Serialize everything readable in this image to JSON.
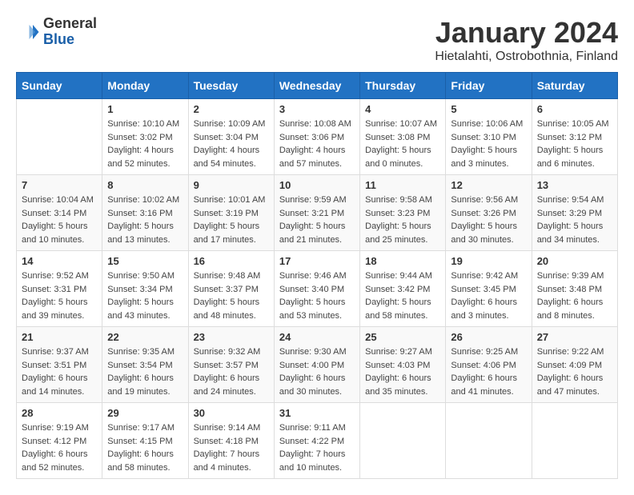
{
  "header": {
    "logo_general": "General",
    "logo_blue": "Blue",
    "month_title": "January 2024",
    "location": "Hietalahti, Ostrobothnia, Finland"
  },
  "days_of_week": [
    "Sunday",
    "Monday",
    "Tuesday",
    "Wednesday",
    "Thursday",
    "Friday",
    "Saturday"
  ],
  "weeks": [
    [
      {
        "day": "",
        "info": ""
      },
      {
        "day": "1",
        "info": "Sunrise: 10:10 AM\nSunset: 3:02 PM\nDaylight: 4 hours\nand 52 minutes."
      },
      {
        "day": "2",
        "info": "Sunrise: 10:09 AM\nSunset: 3:04 PM\nDaylight: 4 hours\nand 54 minutes."
      },
      {
        "day": "3",
        "info": "Sunrise: 10:08 AM\nSunset: 3:06 PM\nDaylight: 4 hours\nand 57 minutes."
      },
      {
        "day": "4",
        "info": "Sunrise: 10:07 AM\nSunset: 3:08 PM\nDaylight: 5 hours\nand 0 minutes."
      },
      {
        "day": "5",
        "info": "Sunrise: 10:06 AM\nSunset: 3:10 PM\nDaylight: 5 hours\nand 3 minutes."
      },
      {
        "day": "6",
        "info": "Sunrise: 10:05 AM\nSunset: 3:12 PM\nDaylight: 5 hours\nand 6 minutes."
      }
    ],
    [
      {
        "day": "7",
        "info": "Sunrise: 10:04 AM\nSunset: 3:14 PM\nDaylight: 5 hours\nand 10 minutes."
      },
      {
        "day": "8",
        "info": "Sunrise: 10:02 AM\nSunset: 3:16 PM\nDaylight: 5 hours\nand 13 minutes."
      },
      {
        "day": "9",
        "info": "Sunrise: 10:01 AM\nSunset: 3:19 PM\nDaylight: 5 hours\nand 17 minutes."
      },
      {
        "day": "10",
        "info": "Sunrise: 9:59 AM\nSunset: 3:21 PM\nDaylight: 5 hours\nand 21 minutes."
      },
      {
        "day": "11",
        "info": "Sunrise: 9:58 AM\nSunset: 3:23 PM\nDaylight: 5 hours\nand 25 minutes."
      },
      {
        "day": "12",
        "info": "Sunrise: 9:56 AM\nSunset: 3:26 PM\nDaylight: 5 hours\nand 30 minutes."
      },
      {
        "day": "13",
        "info": "Sunrise: 9:54 AM\nSunset: 3:29 PM\nDaylight: 5 hours\nand 34 minutes."
      }
    ],
    [
      {
        "day": "14",
        "info": "Sunrise: 9:52 AM\nSunset: 3:31 PM\nDaylight: 5 hours\nand 39 minutes."
      },
      {
        "day": "15",
        "info": "Sunrise: 9:50 AM\nSunset: 3:34 PM\nDaylight: 5 hours\nand 43 minutes."
      },
      {
        "day": "16",
        "info": "Sunrise: 9:48 AM\nSunset: 3:37 PM\nDaylight: 5 hours\nand 48 minutes."
      },
      {
        "day": "17",
        "info": "Sunrise: 9:46 AM\nSunset: 3:40 PM\nDaylight: 5 hours\nand 53 minutes."
      },
      {
        "day": "18",
        "info": "Sunrise: 9:44 AM\nSunset: 3:42 PM\nDaylight: 5 hours\nand 58 minutes."
      },
      {
        "day": "19",
        "info": "Sunrise: 9:42 AM\nSunset: 3:45 PM\nDaylight: 6 hours\nand 3 minutes."
      },
      {
        "day": "20",
        "info": "Sunrise: 9:39 AM\nSunset: 3:48 PM\nDaylight: 6 hours\nand 8 minutes."
      }
    ],
    [
      {
        "day": "21",
        "info": "Sunrise: 9:37 AM\nSunset: 3:51 PM\nDaylight: 6 hours\nand 14 minutes."
      },
      {
        "day": "22",
        "info": "Sunrise: 9:35 AM\nSunset: 3:54 PM\nDaylight: 6 hours\nand 19 minutes."
      },
      {
        "day": "23",
        "info": "Sunrise: 9:32 AM\nSunset: 3:57 PM\nDaylight: 6 hours\nand 24 minutes."
      },
      {
        "day": "24",
        "info": "Sunrise: 9:30 AM\nSunset: 4:00 PM\nDaylight: 6 hours\nand 30 minutes."
      },
      {
        "day": "25",
        "info": "Sunrise: 9:27 AM\nSunset: 4:03 PM\nDaylight: 6 hours\nand 35 minutes."
      },
      {
        "day": "26",
        "info": "Sunrise: 9:25 AM\nSunset: 4:06 PM\nDaylight: 6 hours\nand 41 minutes."
      },
      {
        "day": "27",
        "info": "Sunrise: 9:22 AM\nSunset: 4:09 PM\nDaylight: 6 hours\nand 47 minutes."
      }
    ],
    [
      {
        "day": "28",
        "info": "Sunrise: 9:19 AM\nSunset: 4:12 PM\nDaylight: 6 hours\nand 52 minutes."
      },
      {
        "day": "29",
        "info": "Sunrise: 9:17 AM\nSunset: 4:15 PM\nDaylight: 6 hours\nand 58 minutes."
      },
      {
        "day": "30",
        "info": "Sunrise: 9:14 AM\nSunset: 4:18 PM\nDaylight: 7 hours\nand 4 minutes."
      },
      {
        "day": "31",
        "info": "Sunrise: 9:11 AM\nSunset: 4:22 PM\nDaylight: 7 hours\nand 10 minutes."
      },
      {
        "day": "",
        "info": ""
      },
      {
        "day": "",
        "info": ""
      },
      {
        "day": "",
        "info": ""
      }
    ]
  ]
}
